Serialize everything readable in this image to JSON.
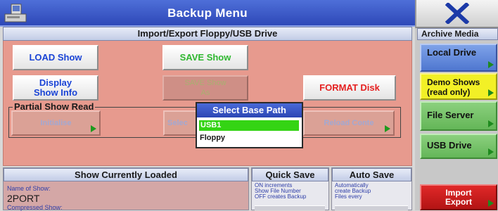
{
  "window": {
    "title": "Backup Menu"
  },
  "import_export": {
    "header": "Import/Export Floppy/USB Drive",
    "load_show": "LOAD Show",
    "save_show": "SAVE Show",
    "display_show_info": [
      "Display",
      "Show Info"
    ],
    "save_show_as": [
      "SAVE Show",
      "As"
    ],
    "format_disk": "FORMAT Disk",
    "partial_show_read": {
      "label": "Partial Show Read",
      "initialise": "Initialise",
      "middle": "Selec",
      "reload": "Reload Conte"
    }
  },
  "popup": {
    "title": "Select Base Path",
    "options": [
      "USB1",
      "Floppy"
    ],
    "selected": "USB1"
  },
  "show_loaded": {
    "header": "Show Currently Loaded",
    "name_label": "Name of Show:",
    "name_value": "2PORT",
    "compressed_label": "Compressed Show:"
  },
  "quick_save": {
    "header": "Quick Save",
    "text": [
      "ON increments",
      "Show File Number",
      "OFF creates Backup"
    ]
  },
  "auto_save": {
    "header": "Auto Save",
    "text": [
      "Automatically",
      "create Backup",
      "Files every"
    ]
  },
  "archive_media": {
    "header": "Archive Media",
    "items": [
      {
        "label": [
          "Local Drive"
        ]
      },
      {
        "label": [
          "Demo Shows",
          "(read only)"
        ]
      },
      {
        "label": [
          "File Server"
        ]
      },
      {
        "label": [
          "USB Drive"
        ]
      },
      {
        "label": [
          "Import",
          "Export"
        ]
      }
    ]
  },
  "colors": {
    "title_bar": "#2e48b8",
    "main_panel": "#e79a8e",
    "selected_option": "#34d414",
    "local_drive": "#4f77d0",
    "demo_shows": "#f2f026",
    "file_server": "#64b658",
    "import_export": "#b31414"
  }
}
